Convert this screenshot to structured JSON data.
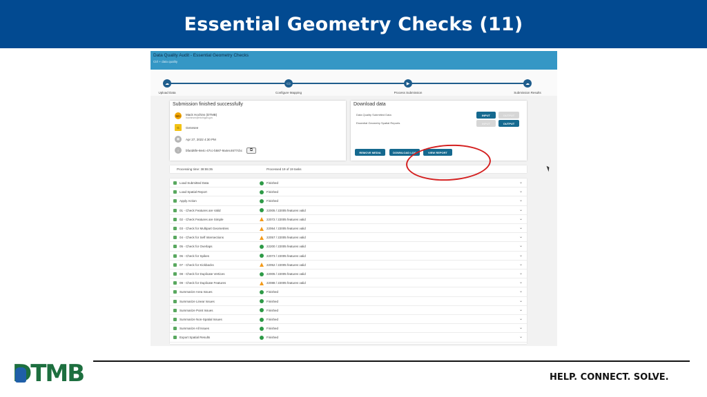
{
  "slide": {
    "title": "Essential Geometry Checks (11)",
    "tagline": "HELP. CONNECT. SOLVE.",
    "logo_text": "DTMB"
  },
  "app": {
    "title": "Data Quality Audit - Essential Geometry Checks",
    "subtitle": "Ctrl + data quality"
  },
  "stepper": {
    "steps": [
      {
        "label": "Upload Data",
        "icon": "cloud-upload-icon"
      },
      {
        "label": "Configure Mapping",
        "icon": "mapping-icon"
      },
      {
        "label": "Process Submission",
        "icon": "play-icon"
      },
      {
        "label": "Submission Results",
        "icon": "cloud-upload-icon"
      }
    ]
  },
  "submission": {
    "title": "Submission finished successfully",
    "avatar": "MH",
    "user_name": "Mack Hochins (DTMB)",
    "user_email": "hochinsm@michigan.gov",
    "org_badge": "G",
    "org": "Genesee",
    "date": "Apr 27, 2022 4:30 PM",
    "id": "bfa4d6fe-8e4c-47cc-b587-9a4ec4677cbc"
  },
  "download": {
    "title": "Download data",
    "rows": [
      {
        "label": "Data Quality Submitted Data",
        "input_label": "INPUT",
        "output_label": "OUTPUT",
        "input_enabled": true,
        "output_enabled": false
      },
      {
        "label": "Essential Geometry Spatial Reports",
        "input_label": "INPUT",
        "output_label": "OUTPUT",
        "input_enabled": false,
        "output_enabled": true
      }
    ],
    "actions": {
      "remove_media": "REMOVE MEDIA",
      "download_log": "DOWNLOAD LOG",
      "view_report": "VIEW REPORT"
    }
  },
  "processing": {
    "time": "Processing time: 38:55:35",
    "progress": "Processed 19 of 19 tasks"
  },
  "tasks": [
    {
      "name": "Load Submitted Data",
      "status": "Finished",
      "level": "ok"
    },
    {
      "name": "Load Spatial Report",
      "status": "Finished",
      "level": "ok"
    },
    {
      "name": "Apply Action",
      "status": "Finished",
      "level": "ok"
    },
    {
      "name": "01 - Check Features are Valid",
      "status": "22005 / 22005 features valid",
      "level": "ok"
    },
    {
      "name": "02 - Check Features are Simple",
      "status": "22072 / 22005 features valid",
      "level": "warn"
    },
    {
      "name": "03 - Check for Multipart Geometries",
      "status": "22064 / 22005 features valid",
      "level": "warn"
    },
    {
      "name": "04 - Check for Self Intersections",
      "status": "22057 / 22005 features valid",
      "level": "warn"
    },
    {
      "name": "05 - Check for Overlaps",
      "status": "22200 / 22005 features valid",
      "level": "ok"
    },
    {
      "name": "06 - Check for Spikes",
      "status": "22073 / 22005 features valid",
      "level": "ok"
    },
    {
      "name": "07 - Check for Kickbacks",
      "status": "22052 / 22005 features valid",
      "level": "warn"
    },
    {
      "name": "08 - Check for Duplicate Vertices",
      "status": "22005 / 22005 features valid",
      "level": "ok"
    },
    {
      "name": "09 - Check for Duplicate Features",
      "status": "22088 / 22005 features valid",
      "level": "warn"
    },
    {
      "name": "Summarize Area Issues",
      "status": "Finished",
      "level": "ok"
    },
    {
      "name": "Summarize Linear Issues",
      "status": "Finished",
      "level": "ok"
    },
    {
      "name": "Summarize Point Issues",
      "status": "Finished",
      "level": "ok"
    },
    {
      "name": "Summarize Non-Spatial Issues",
      "status": "Finished",
      "level": "ok"
    },
    {
      "name": "Summarize All Issues",
      "status": "Finished",
      "level": "ok"
    },
    {
      "name": "Export Spatial Results",
      "status": "Finished",
      "level": "ok"
    }
  ],
  "colors": {
    "title_bar": "#024a91",
    "app_header": "#3597c5",
    "button": "#15698f",
    "ok": "#2e9a47",
    "warn": "#f39a1a",
    "highlight": "#d42020",
    "logo_green": "#1d6f3f"
  }
}
